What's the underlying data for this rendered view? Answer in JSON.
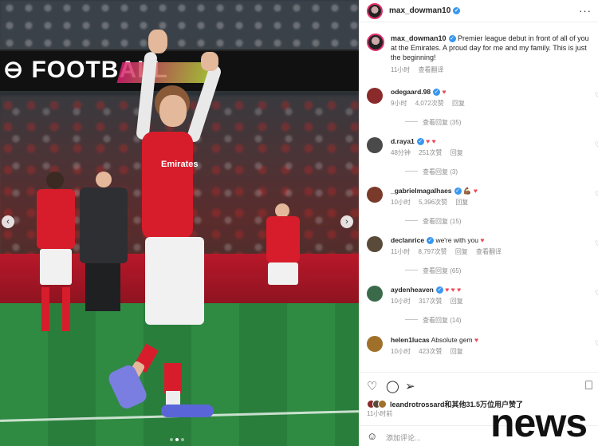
{
  "post": {
    "username": "max_dowman10",
    "caption": "Premier league debut in front of all of you at the Emirates. A proud day for me and my family. This is just the beginning!",
    "time": "11小时",
    "translate": "查看翻译"
  },
  "photo": {
    "banner_text": "FOOTBALL"
  },
  "comments": [
    {
      "user": "odegaard.98",
      "text": "",
      "hearts": "♥",
      "time": "9小时",
      "likes": "4,072次赞",
      "reply": "回复",
      "replies": "查看回复 (35)",
      "avatar_color": "#8a2a2a"
    },
    {
      "user": "d.raya1",
      "text": "",
      "hearts": "♥ ♥",
      "time": "48分钟",
      "likes": "251次赞",
      "reply": "回复",
      "replies": "查看回复 (3)",
      "avatar_color": "#4a4a4a"
    },
    {
      "user": "_gabrielmagalhaes",
      "text": "💪🏾 ♥",
      "hearts": "",
      "time": "10小时",
      "likes": "5,396次赞",
      "reply": "回复",
      "replies": "查看回复 (15)",
      "avatar_color": "#7a3a2a"
    },
    {
      "user": "declanrice",
      "text": "we're with you",
      "hearts": "♥",
      "time": "11小时",
      "likes": "8,797次赞",
      "reply": "回复",
      "translate": "查看翻译",
      "replies": "查看回复 (65)",
      "avatar_color": "#5a4a3a"
    },
    {
      "user": "aydenheaven",
      "text": "",
      "hearts": "♥ ♥ ♥",
      "time": "10小时",
      "likes": "317次赞",
      "reply": "回复",
      "replies": "查看回复 (14)",
      "avatar_color": "#3a6a4a"
    },
    {
      "user": "helen1lucas",
      "text": "Absolute gem",
      "hearts": "♥",
      "time": "10小时",
      "likes": "423次赞",
      "reply": "回复",
      "avatar_color": "#a0702a"
    }
  ],
  "likes_line": {
    "liker": "leandrotrossard",
    "and_others": "和其他31.5万位用户赞了",
    "time": "11小时前"
  },
  "add_comment_placeholder": "添加评论...",
  "watermark": "news",
  "icons": {
    "more": "more-icon",
    "heart": "heart-icon",
    "comment": "comment-icon",
    "share": "share-icon",
    "bookmark": "bookmark-icon",
    "emoji": "emoji-icon"
  }
}
